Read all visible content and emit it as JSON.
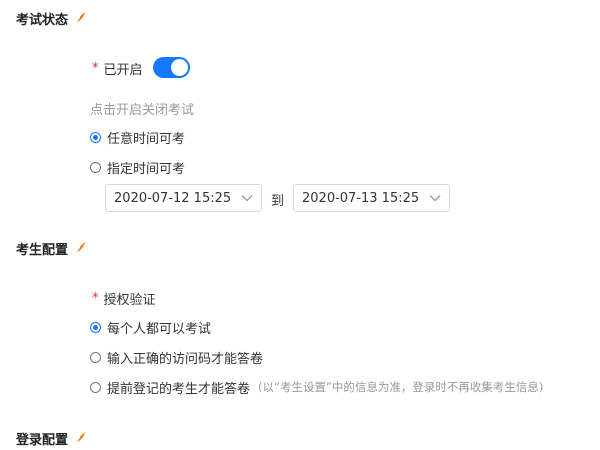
{
  "exam_status": {
    "title": "考试状态",
    "enabled_label": "已开启",
    "hint": "点击开启关闭考试",
    "options": [
      "任意时间可考",
      "指定时间可考"
    ],
    "start_time": "2020-07-12 15:25",
    "to_label": "到",
    "end_time": "2020-07-13 15:25"
  },
  "candidate_config": {
    "title": "考生配置",
    "auth_label": "授权验证",
    "options": [
      "每个人都可以考试",
      "输入正确的访问码才能答卷",
      "提前登记的考生才能答卷"
    ],
    "option3_note": "(以“考生设置”中的信息为准，登录时不再收集考生信息)"
  },
  "login_config": {
    "title": "登录配置"
  },
  "colors": {
    "accent": "#1677ff",
    "required_star": "#f5222d",
    "feather_icon": "#f07d1d"
  }
}
